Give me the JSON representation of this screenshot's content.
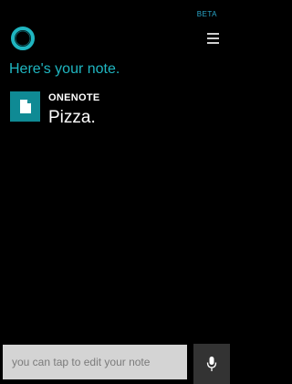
{
  "status": {
    "badge": "BETA"
  },
  "header": {
    "menu_icon": "hamburger-menu-icon",
    "assistant_icon": "cortana-circle-icon"
  },
  "response": {
    "heading": "Here's your note."
  },
  "note": {
    "app": "ONENOTE",
    "app_icon": "document-icon",
    "content": "Pizza."
  },
  "input": {
    "placeholder": "you can tap to edit your note",
    "mic_icon": "microphone-icon"
  },
  "colors": {
    "accent": "#1fb6c1",
    "tile": "#0f8a94",
    "background": "#000000",
    "input_bg": "#d4d4d4"
  }
}
